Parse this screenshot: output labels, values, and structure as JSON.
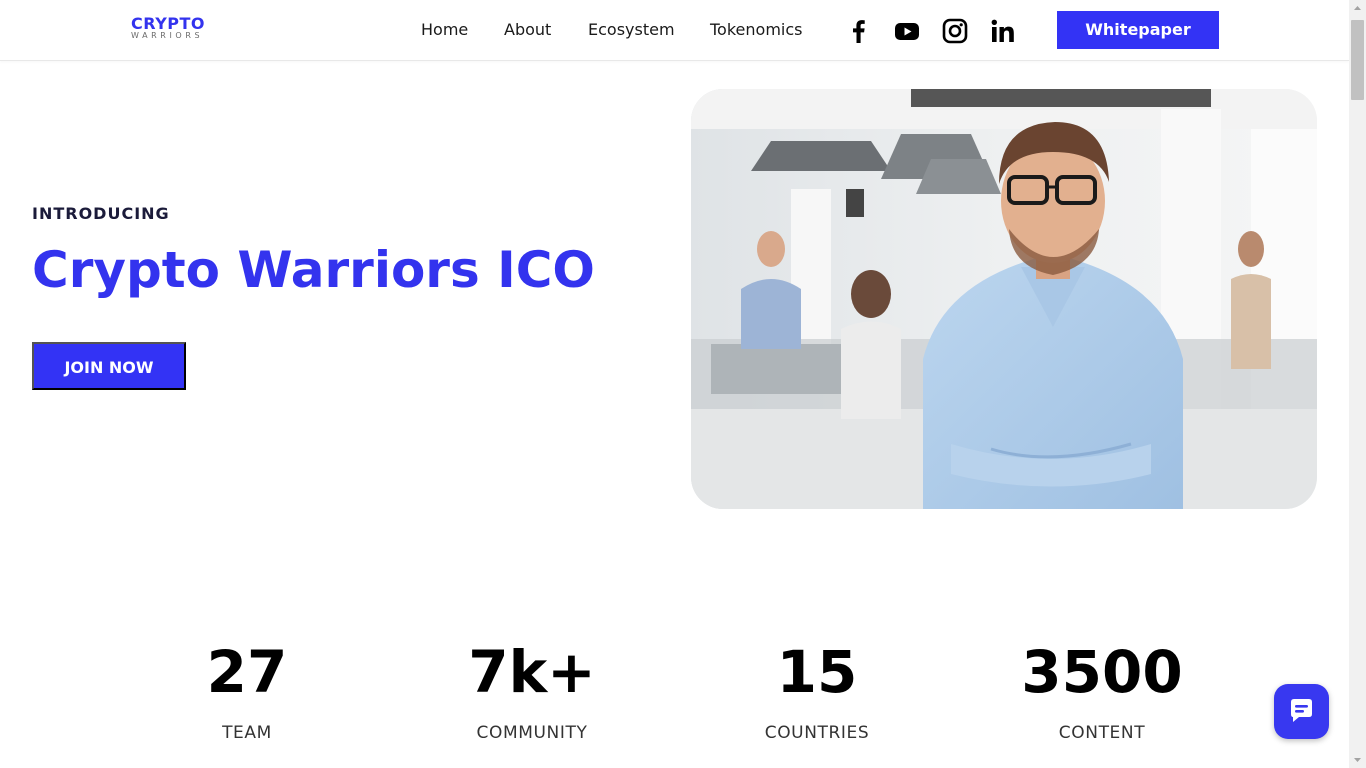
{
  "header": {
    "logo": {
      "top": "CRYPTO",
      "bottom": "WARRIORS"
    },
    "nav": [
      "Home",
      "About",
      "Ecosystem",
      "Tokenomics"
    ],
    "social_icons": [
      "facebook-icon",
      "youtube-icon",
      "instagram-icon",
      "linkedin-icon"
    ],
    "cta_label": "Whitepaper"
  },
  "hero": {
    "eyebrow": "INTRODUCING",
    "title": "Crypto Warriors ICO",
    "button_label": "JOIN NOW",
    "image_subject": "smiling man with glasses in office"
  },
  "stats": [
    {
      "value": "27",
      "label": "TEAM"
    },
    {
      "value": "7k+",
      "label": "COMMUNITY"
    },
    {
      "value": "15",
      "label": "COUNTRIES"
    },
    {
      "value": "3500",
      "label": "CONTENT"
    }
  ],
  "colors": {
    "accent": "#3333f5",
    "text": "#111111",
    "background": "#ffffff"
  }
}
